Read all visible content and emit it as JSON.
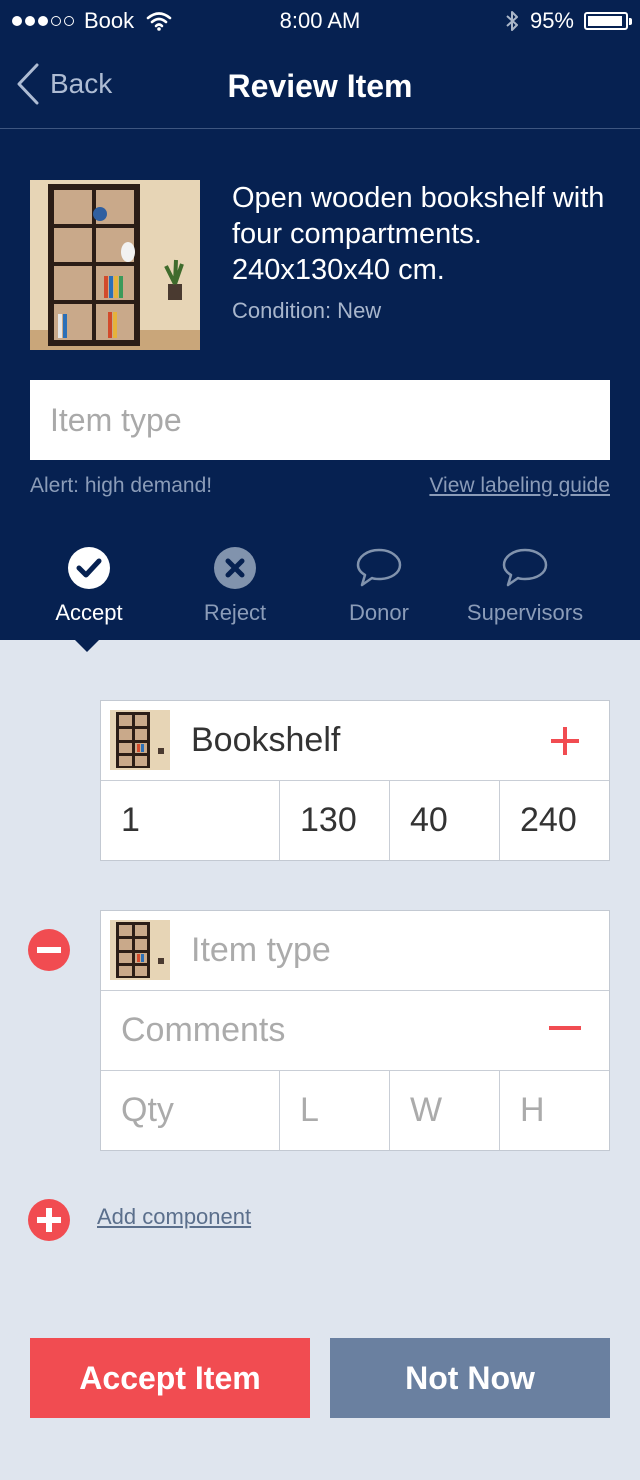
{
  "status_bar": {
    "carrier": "Book",
    "time": "8:00 AM",
    "battery": "95%"
  },
  "nav": {
    "back_label": "Back",
    "title": "Review Item"
  },
  "item": {
    "description": "Open wooden bookshelf with four compartments. 240x130x40 cm.",
    "condition": "Condition: New"
  },
  "item_type_input": {
    "placeholder": "Item type",
    "value": ""
  },
  "alert": "Alert: high demand!",
  "guide_link": "View labeling guide",
  "tabs": [
    {
      "label": "Accept",
      "icon": "check-circle-icon",
      "active": true
    },
    {
      "label": "Reject",
      "icon": "x-circle-icon",
      "active": false
    },
    {
      "label": "Donor",
      "icon": "chat-bubble-icon",
      "active": false
    },
    {
      "label": "Supervisors",
      "icon": "chat-bubble-icon",
      "active": false
    }
  ],
  "components": [
    {
      "type": "Bookshelf",
      "qty": "1",
      "l": "130",
      "w": "40",
      "h": "240"
    },
    {
      "type_placeholder": "Item type",
      "comments_placeholder": "Comments",
      "qty_placeholder": "Qty",
      "l_placeholder": "L",
      "w_placeholder": "W",
      "h_placeholder": "H"
    }
  ],
  "add_component": "Add component",
  "buttons": {
    "accept": "Accept Item",
    "not_now": "Not Now"
  },
  "colors": {
    "header": "#062151",
    "accent_red": "#f14c51",
    "secondary": "#6a80a0",
    "background": "#dfe5ee"
  }
}
